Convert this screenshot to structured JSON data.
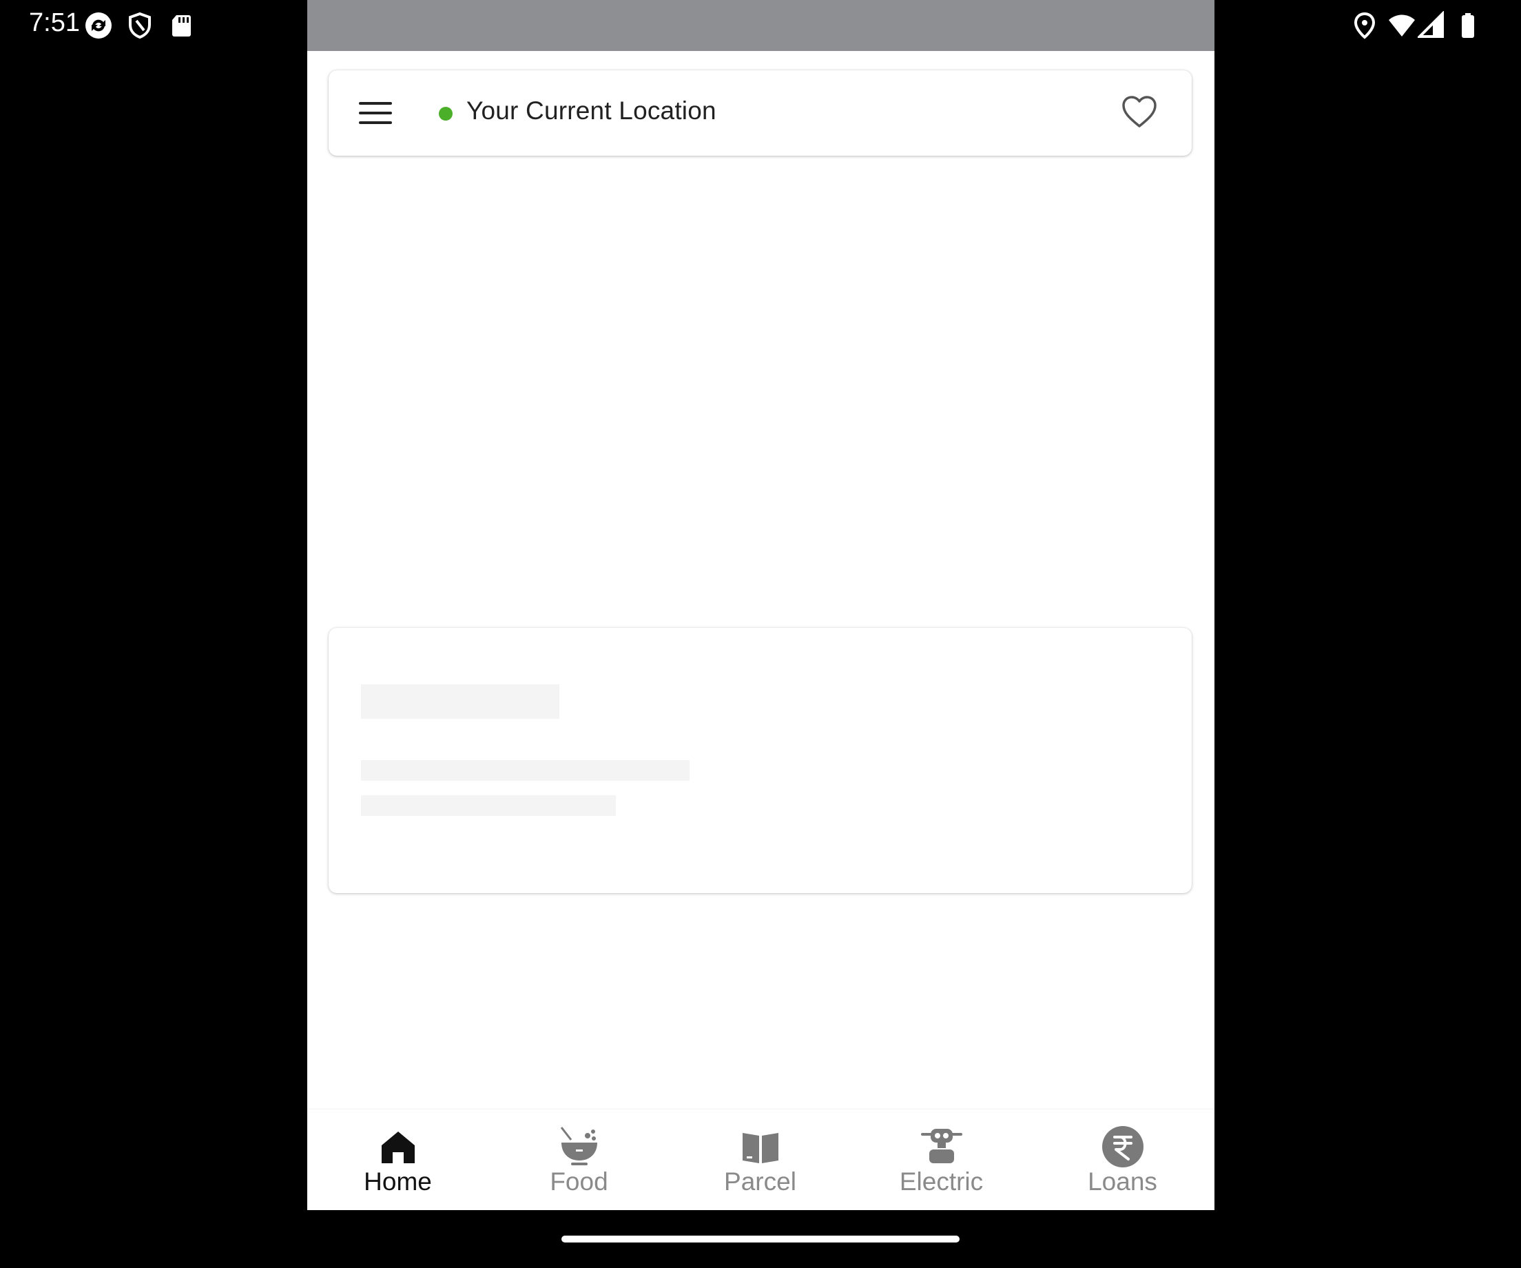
{
  "status_bar": {
    "time": "7:51",
    "left_icons": [
      "sync-icon",
      "shield-icon",
      "sd-card-icon"
    ],
    "right_icons": [
      "location-icon",
      "wifi-icon",
      "cellular-signal-icon",
      "battery-icon"
    ]
  },
  "top_bar": {
    "menu_icon": "menu-icon",
    "location_status_color": "#4caf2a",
    "location_label": "Your Current Location",
    "favorite_icon": "heart-outline-icon"
  },
  "loading_card": {
    "state": "skeleton-placeholder"
  },
  "bottom_nav": {
    "active": "Home",
    "items": [
      {
        "label": "Home",
        "icon": "home-icon"
      },
      {
        "label": "Food",
        "icon": "food-bowl-icon"
      },
      {
        "label": "Parcel",
        "icon": "parcel-box-icon"
      },
      {
        "label": "Electric",
        "icon": "electric-scooter-icon"
      },
      {
        "label": "Loans",
        "icon": "rupee-icon"
      }
    ]
  },
  "colors": {
    "accent_green": "#4caf2a",
    "nav_active": "#111111",
    "nav_inactive": "#8a8a8a",
    "scrim": "#8e8f92"
  }
}
